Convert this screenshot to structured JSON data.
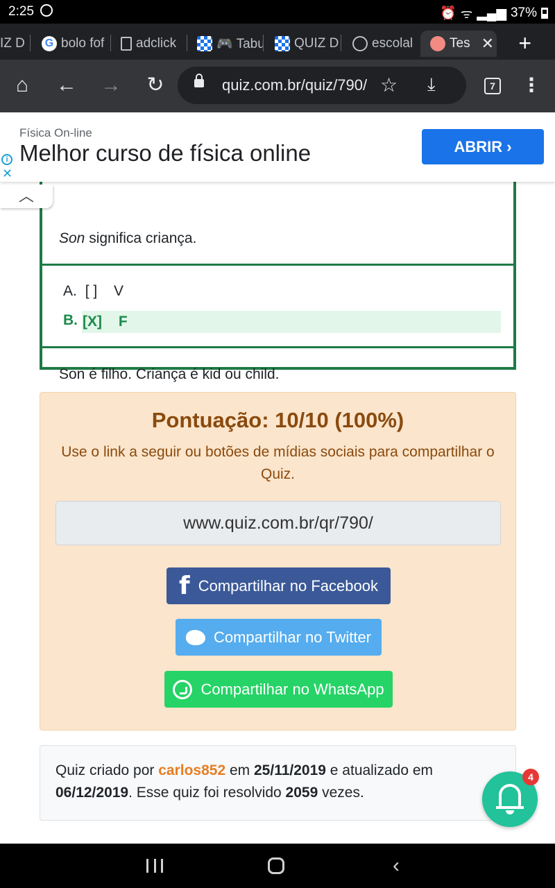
{
  "status": {
    "time": "2:25",
    "battery": "37%"
  },
  "tabs": [
    {
      "label": "IZ D",
      "favicon": "quiz-icon"
    },
    {
      "label": "bolo fof",
      "favicon": "google-icon"
    },
    {
      "label": "adclick",
      "favicon": "document-icon"
    },
    {
      "label": "🎮 Tabu",
      "favicon": "quiz-icon"
    },
    {
      "label": "QUIZ D",
      "favicon": "quiz-icon"
    },
    {
      "label": "escolal",
      "favicon": "globe-icon"
    },
    {
      "label": "Tes",
      "favicon": "brain-icon",
      "active": true
    }
  ],
  "toolbar": {
    "url": "quiz.com.br/quiz/790/",
    "tab_count": "7"
  },
  "ad": {
    "sponsor": "Física On-line",
    "title": "Melhor curso de física online",
    "button": "ABRIR"
  },
  "question": {
    "text_em": "Son",
    "text_rest": " significa criança.",
    "options": [
      {
        "letter": "A.",
        "mark": "[ ]",
        "value": "V",
        "correct": false
      },
      {
        "letter": "B.",
        "mark": "[X]",
        "value": "F",
        "correct": true
      }
    ],
    "explanation": "Son é filho. Criança é kid ou child."
  },
  "score": {
    "title": "Pontuação: 10/10 (100%)",
    "description": "Use o link a seguir ou botões de mídias sociais para compartilhar o Quiz.",
    "link": "www.quiz.com.br/qr/790/",
    "facebook": "Compartilhar no Facebook",
    "twitter": "Compartilhar no Twitter",
    "whatsapp": "Compartilhar no WhatsApp"
  },
  "info": {
    "prefix": "Quiz criado por ",
    "author": "carlos852",
    "mid1": " em ",
    "created": "25/11/2019",
    "mid2": " e atualizado em ",
    "updated": "06/12/2019",
    "mid3": ". Esse quiz foi resolvido ",
    "solved": "2059",
    "suffix": " vezes."
  },
  "notification": {
    "count": "4"
  }
}
